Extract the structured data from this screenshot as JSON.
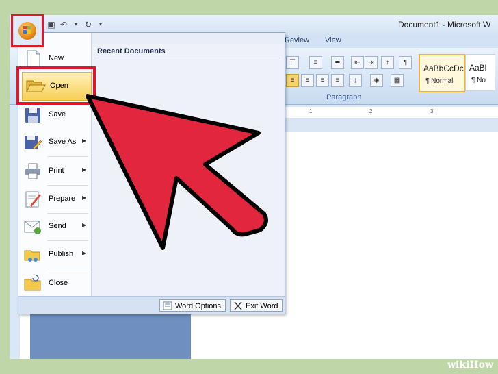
{
  "window": {
    "title": "Document1 - Microsoft W"
  },
  "ribbon": {
    "tabs": [
      "Review",
      "View"
    ],
    "paragraph_label": "Paragraph",
    "styles": [
      {
        "sample": "AaBbCcDc",
        "name": "¶ Normal"
      },
      {
        "sample": "AaBl",
        "name": "¶ No"
      }
    ],
    "ruler_marks": [
      "1",
      "2",
      "3"
    ]
  },
  "office_menu": {
    "items": [
      {
        "label": "New",
        "icon": "new-document-icon",
        "submenu": false
      },
      {
        "label": "Open",
        "icon": "open-folder-icon",
        "submenu": false
      },
      {
        "label": "Save",
        "icon": "save-disk-icon",
        "submenu": false
      },
      {
        "label": "Save As",
        "icon": "save-as-icon",
        "submenu": true
      },
      {
        "label": "Print",
        "icon": "printer-icon",
        "submenu": true
      },
      {
        "label": "Prepare",
        "icon": "prepare-icon",
        "submenu": true
      },
      {
        "label": "Send",
        "icon": "send-icon",
        "submenu": true
      },
      {
        "label": "Publish",
        "icon": "publish-icon",
        "submenu": true
      },
      {
        "label": "Close",
        "icon": "close-folder-icon",
        "submenu": false
      }
    ],
    "recent_documents_title": "Recent Documents",
    "footer": {
      "word_options": "Word Options",
      "exit_word": "Exit Word"
    }
  },
  "watermark": {
    "wiki": "wiki",
    "how": "How"
  },
  "colors": {
    "highlight_red": "#e0162b",
    "open_yellow": "#f7cf57"
  }
}
